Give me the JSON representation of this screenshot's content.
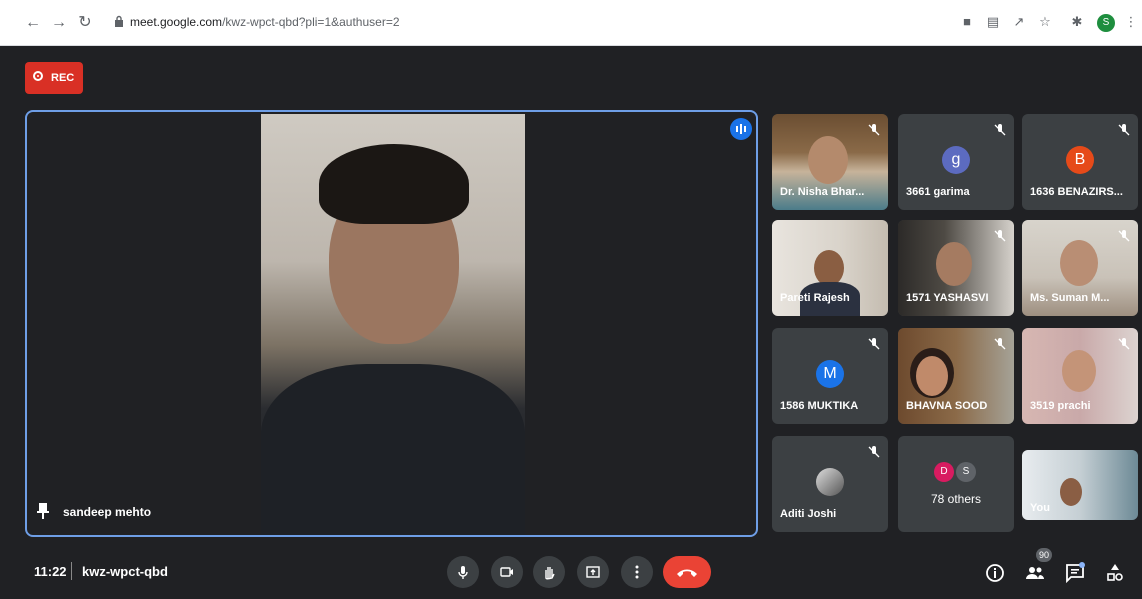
{
  "browser": {
    "url_host": "meet.google.com",
    "url_path": "/kwz-wpct-qbd?pli=1&authuser=2",
    "profile_initial": "S"
  },
  "recording": {
    "label": "REC"
  },
  "main": {
    "speaker_name": "sandeep mehto"
  },
  "tiles": [
    {
      "name": "Dr. Nisha Bhar..."
    },
    {
      "name": "3661 garima",
      "avatar": "g"
    },
    {
      "name": "1636 BENAZIRS...",
      "avatar": "B"
    },
    {
      "name": "Pareti Rajesh"
    },
    {
      "name": "1571 YASHASVI"
    },
    {
      "name": "Ms. Suman M..."
    },
    {
      "name": "1586 MUKTIKA",
      "avatar": "M"
    },
    {
      "name": "BHAVNA SOOD"
    },
    {
      "name": "3519 prachi"
    },
    {
      "name": "Aditi Joshi"
    },
    {
      "name": "78 others",
      "avatar1": "D",
      "avatar2": "S"
    },
    {
      "name": "You"
    }
  ],
  "bottom": {
    "time": "11:22",
    "meeting_code": "kwz-wpct-qbd",
    "participants_count": "90"
  },
  "colors": {
    "accent_blue": "#1a73e8",
    "rec_red": "#d93025",
    "end_call_red": "#ea4335",
    "tile_bg": "#3c4043",
    "page_bg": "#202124"
  }
}
